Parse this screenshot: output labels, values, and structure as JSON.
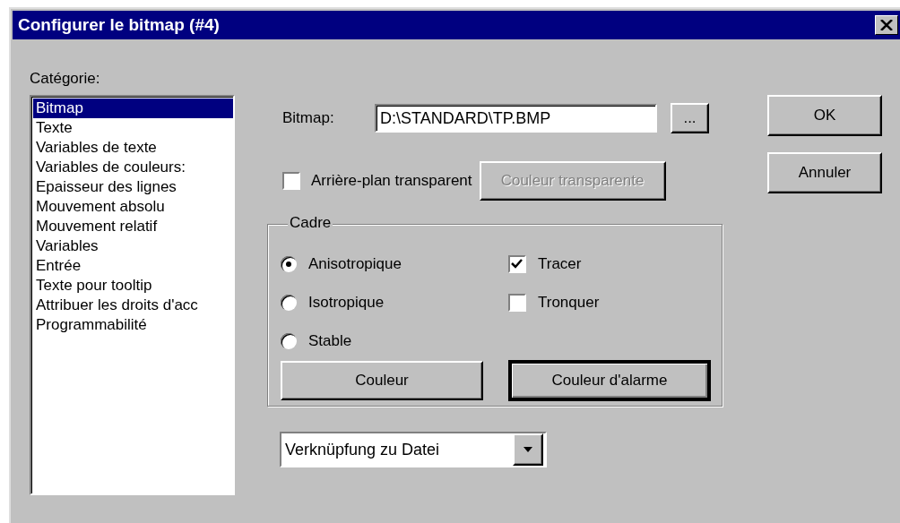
{
  "window": {
    "title": "Configurer le bitmap (#4)"
  },
  "category": {
    "label": "Catégorie:",
    "items": [
      {
        "label": "Bitmap",
        "selected": true
      },
      {
        "label": "Texte",
        "selected": false
      },
      {
        "label": "Variables de texte",
        "selected": false
      },
      {
        "label": "Variables de couleurs:",
        "selected": false
      },
      {
        "label": "Epaisseur des lignes",
        "selected": false
      },
      {
        "label": "Mouvement absolu",
        "selected": false
      },
      {
        "label": "Mouvement relatif",
        "selected": false
      },
      {
        "label": "Variables",
        "selected": false
      },
      {
        "label": "Entrée",
        "selected": false
      },
      {
        "label": "Texte pour tooltip",
        "selected": false
      },
      {
        "label": "Attribuer les droits d'acc",
        "selected": false
      },
      {
        "label": "Programmabilité",
        "selected": false
      }
    ]
  },
  "bitmap": {
    "label": "Bitmap:",
    "value": "D:\\STANDARD\\TP.BMP",
    "browse_button": "..."
  },
  "transparent_background": {
    "label": "Arrière-plan transparent",
    "checked": false
  },
  "transparent_color_button": {
    "label": "Couleur transparente",
    "disabled": true
  },
  "frame": {
    "title": "Cadre",
    "options": [
      {
        "label": "Anisotropique",
        "selected": true
      },
      {
        "label": "Isotropique",
        "selected": false
      },
      {
        "label": "Stable",
        "selected": false
      }
    ],
    "checkboxes": [
      {
        "label": "Tracer",
        "checked": true
      },
      {
        "label": "Tronquer",
        "checked": false
      }
    ],
    "buttons": [
      {
        "label": "Couleur",
        "focused": false
      },
      {
        "label": "Couleur d'alarme",
        "focused": true
      }
    ]
  },
  "link_dropdown": {
    "value": "Verknüpfung zu Datei"
  },
  "buttons": [
    {
      "label": "OK"
    },
    {
      "label": "Annuler"
    }
  ]
}
